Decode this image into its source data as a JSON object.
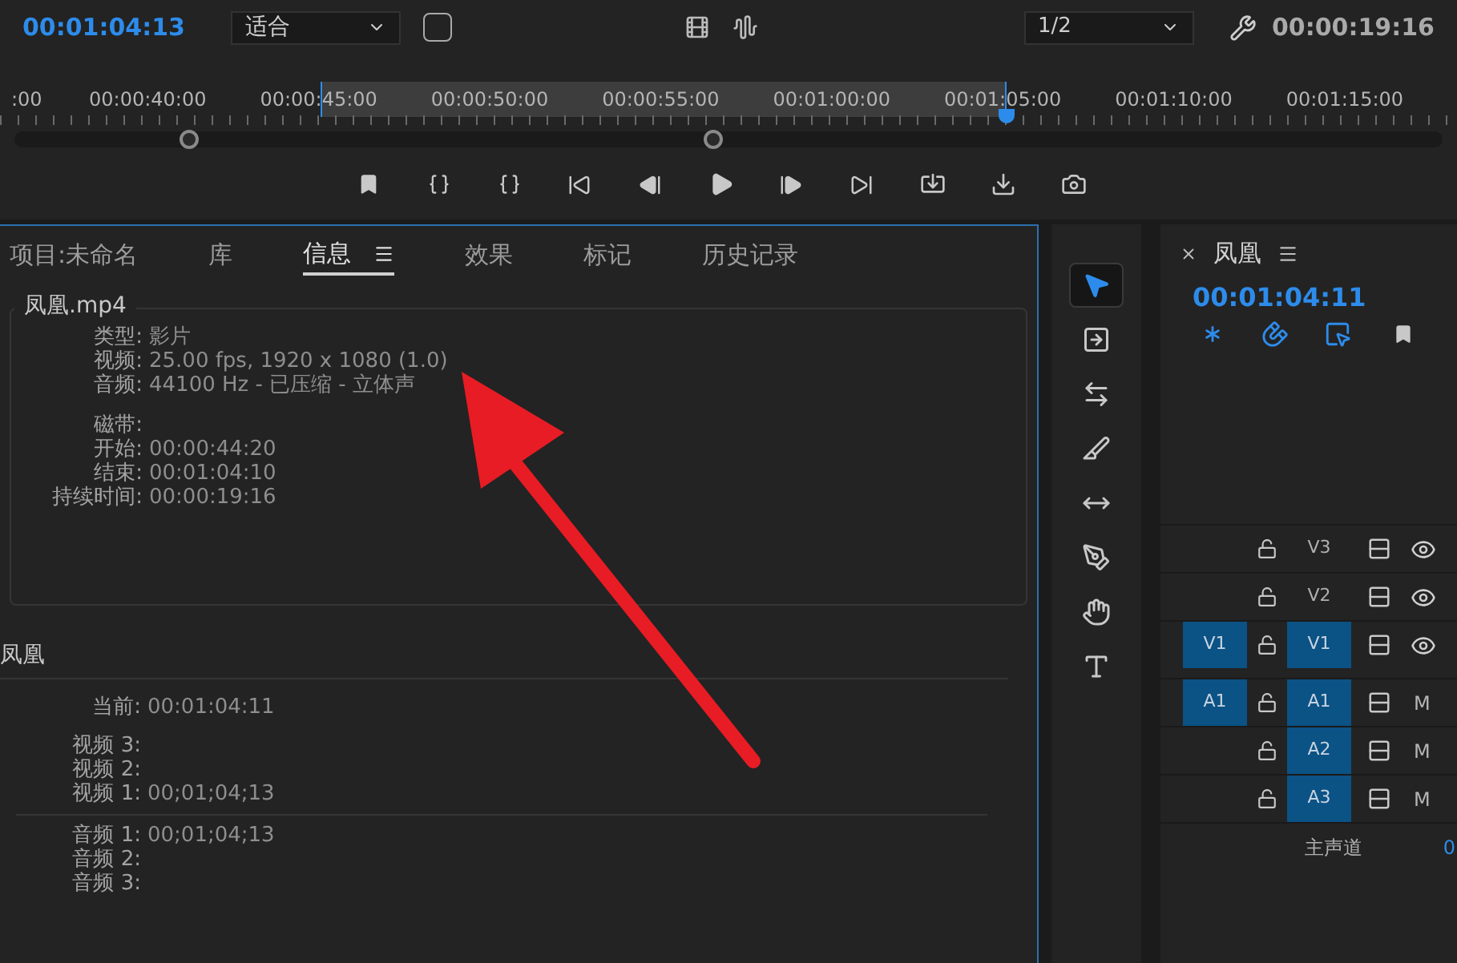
{
  "monitor": {
    "timecode": "00:01:04:13",
    "zoom": "适合",
    "resolution": "1/2",
    "duration": "00:00:19:16",
    "ruler": [
      ":00",
      "00:00:40:00",
      "00:00:45:00",
      "00:00:50:00",
      "00:00:55:00",
      "00:01:00:00",
      "00:01:05:00",
      "00:01:10:00",
      "00:01:15:00"
    ]
  },
  "panel": {
    "tabs": [
      {
        "label": "项目:未命名",
        "selected": false
      },
      {
        "label": "库",
        "selected": false
      },
      {
        "label": "信息",
        "selected": true
      },
      {
        "label": "效果",
        "selected": false
      },
      {
        "label": "标记",
        "selected": false
      },
      {
        "label": "历史记录",
        "selected": false
      }
    ],
    "clip": {
      "title": "凤凰.mp4",
      "properties": [
        {
          "label": "类型:",
          "value": "影片"
        },
        {
          "label": "视频:",
          "value": "25.00 fps, 1920 x 1080 (1.0)"
        },
        {
          "label": "音频:",
          "value": "44100 Hz - 已压缩 - 立体声"
        }
      ],
      "timing": [
        {
          "label": "磁带:"
        },
        {
          "label": "开始:",
          "value": "00:00:44:20"
        },
        {
          "label": "结束:",
          "value": "00:01:04:10"
        },
        {
          "label": "持续时间:",
          "value": "00:00:19:16"
        }
      ]
    },
    "sequence": {
      "title": "凤凰",
      "current": {
        "label": "当前:",
        "value": "00:01:04:11"
      },
      "video": [
        {
          "label": "视频 3:"
        },
        {
          "label": "视频 2:"
        },
        {
          "label": "视频 1:",
          "value": "00;01;04;13"
        }
      ],
      "audio": [
        {
          "label": "音频 1:",
          "value": "00;01;04;13"
        },
        {
          "label": "音频 2:"
        },
        {
          "label": "音频 3:"
        }
      ]
    }
  },
  "tools": [
    {
      "kind": "selection",
      "selected": true
    },
    {
      "kind": "track-select",
      "selected": false
    },
    {
      "kind": "ripple",
      "selected": false
    },
    {
      "kind": "razor",
      "selected": false
    },
    {
      "kind": "slip",
      "selected": false
    },
    {
      "kind": "pen",
      "selected": false
    },
    {
      "kind": "hand",
      "selected": false
    },
    {
      "kind": "type",
      "selected": false
    }
  ],
  "timeline": {
    "title": "凤凰",
    "timecode": "00:01:04:11",
    "tracks": [
      {
        "kind": "video",
        "name": "V3",
        "target_on": false
      },
      {
        "kind": "video",
        "name": "V2",
        "target_on": false
      },
      {
        "kind": "video",
        "source": "V1",
        "source_on": true,
        "name": "V1",
        "target_on": true
      },
      {
        "kind": "audio",
        "source": "A1",
        "source_on": true,
        "name": "A1",
        "target_on": true,
        "toggle": "M"
      },
      {
        "kind": "audio",
        "name": "A2",
        "target_on": true,
        "toggle": "M"
      },
      {
        "kind": "audio",
        "name": "A3",
        "target_on": true,
        "toggle": "M"
      }
    ],
    "master": {
      "label": "主声道",
      "value": "0"
    }
  }
}
